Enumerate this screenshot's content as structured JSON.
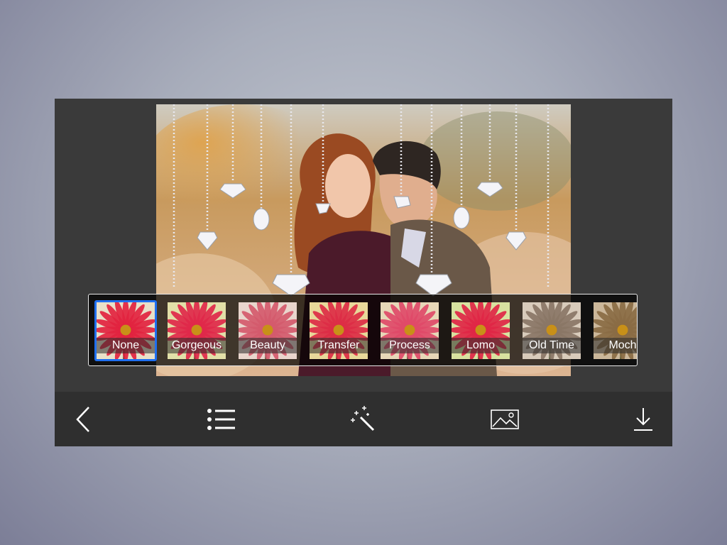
{
  "filters": [
    {
      "label": "None",
      "tint": "#e8e0c8",
      "petal": "#e2233f",
      "selected": true
    },
    {
      "label": "Gorgeous",
      "tint": "#e2e0a8",
      "petal": "#e0284a",
      "selected": false
    },
    {
      "label": "Beauty",
      "tint": "#e9d6cd",
      "petal": "#d45a6c",
      "selected": false
    },
    {
      "label": "Transfer",
      "tint": "#e8d89a",
      "petal": "#dc2c45",
      "selected": false
    },
    {
      "label": "Process",
      "tint": "#e7d7b8",
      "petal": "#e04a68",
      "selected": false
    },
    {
      "label": "Lomo",
      "tint": "#d8e2a0",
      "petal": "#e02645",
      "selected": false
    },
    {
      "label": "Old Time",
      "tint": "#d8cbbb",
      "petal": "#8a7666",
      "selected": false
    },
    {
      "label": "Moch",
      "tint": "#cbb79a",
      "petal": "#8a6b44",
      "selected": false
    }
  ],
  "toolbar": {
    "back_icon": "chevron-left-icon",
    "list_icon": "list-icon",
    "magic_icon": "magic-wand-icon",
    "image_icon": "image-icon",
    "download_icon": "download-icon"
  },
  "colors": {
    "selected_border": "#1f6ff0",
    "toolbar_bg": "#2f2f2f",
    "panel_bg": "#3a3a3a"
  }
}
